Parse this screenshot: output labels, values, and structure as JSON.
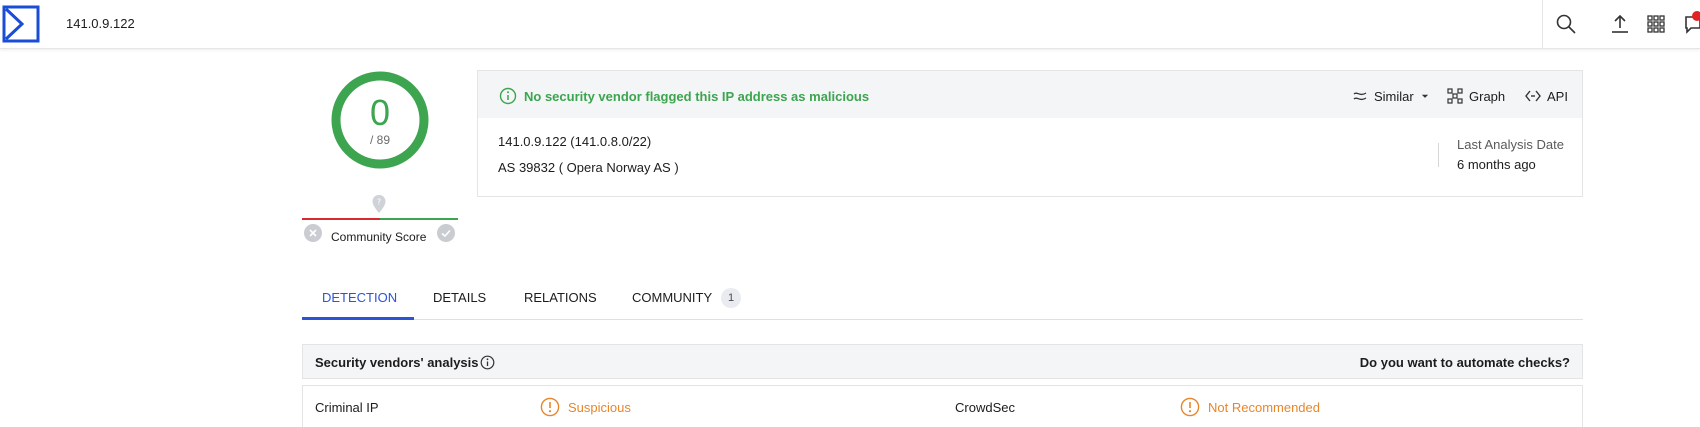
{
  "header": {
    "search_value": "141.0.9.122",
    "icons": [
      "sigma-logo-icon",
      "search-icon",
      "upload-icon",
      "apps-grid-icon",
      "notifications-icon"
    ]
  },
  "score": {
    "detections": "0",
    "total": "/ 89",
    "community_label": "Community Score",
    "colors": {
      "clean": "#3da44f",
      "malicious": "#d9282f"
    }
  },
  "summary": {
    "status_text": "No security vendor flagged this IP address as malicious",
    "actions": {
      "similar": "Similar",
      "graph": "Graph",
      "api": "API"
    },
    "ip_range": "141.0.9.122  (141.0.8.0/22)",
    "asn": "AS 39832  ( Opera Norway AS )",
    "last_analysis_label": "Last Analysis Date",
    "last_analysis_value": "6 months ago"
  },
  "tabs": [
    {
      "label": "DETECTION",
      "active": true
    },
    {
      "label": "DETAILS"
    },
    {
      "label": "RELATIONS"
    },
    {
      "label": "COMMUNITY",
      "badge": "1"
    }
  ],
  "vendors": {
    "title": "Security vendors' analysis",
    "automate_text": "Do you want to automate checks?",
    "rows": [
      {
        "left_name": "Criminal IP",
        "left_status": "Suspicious",
        "right_name": "CrowdSec",
        "right_status": "Not Recommended"
      }
    ],
    "status_color": "#e8862a"
  }
}
